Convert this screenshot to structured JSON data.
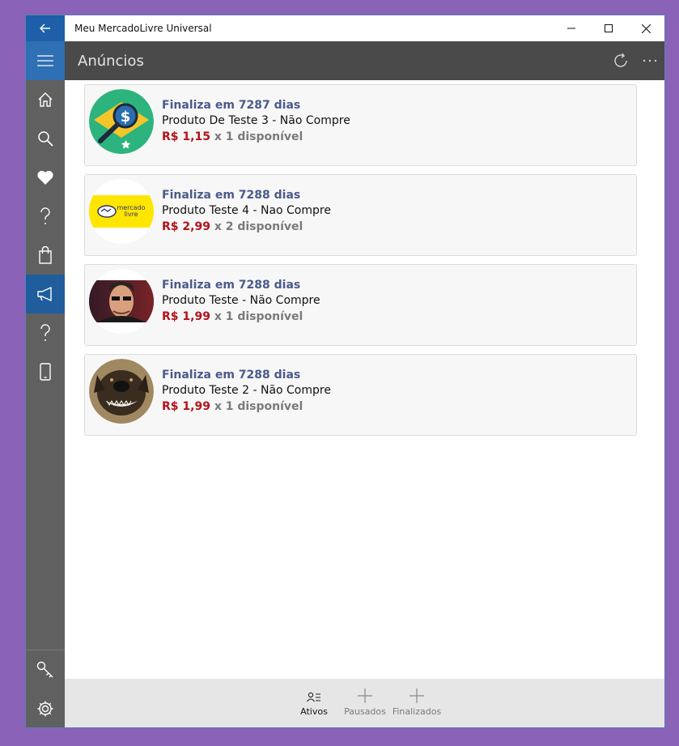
{
  "window": {
    "title": "Meu MercadoLivre Universal"
  },
  "header": {
    "title": "Anúncios"
  },
  "sidebar": {
    "items": [
      {
        "icon": "home-icon"
      },
      {
        "icon": "search-icon"
      },
      {
        "icon": "heart-icon"
      },
      {
        "icon": "help-icon"
      },
      {
        "icon": "shopping-bag-icon"
      },
      {
        "icon": "megaphone-icon",
        "active": true
      },
      {
        "icon": "help-icon"
      },
      {
        "icon": "phone-icon"
      }
    ],
    "bottom": [
      {
        "icon": "keys-icon"
      },
      {
        "icon": "gear-icon"
      }
    ]
  },
  "listings": [
    {
      "ends_label": "Finaliza em  7287 dias",
      "name": "Produto De Teste 3 - Não Compre",
      "price": "R$ 1,15",
      "qty": "x 1 disponível",
      "image": "dollar-magnifier"
    },
    {
      "ends_label": "Finaliza em  7288 dias",
      "name": "Produto Teste 4 - Nao Compre",
      "price": "R$ 2,99",
      "qty": "x 2 disponível",
      "image": "mercadolivre-logo",
      "logo_text": "mercado livre"
    },
    {
      "ends_label": "Finaliza em  7288 dias",
      "name": "Produto Teste - Não Compre",
      "price": "R$ 1,99",
      "qty": "x 1 disponível",
      "image": "man-portrait"
    },
    {
      "ends_label": "Finaliza em  7288 dias",
      "name": "Produto Teste 2 - Não Compre",
      "price": "R$ 1,99",
      "qty": "x 1 disponível",
      "image": "dog-photo"
    }
  ],
  "cmdbar": {
    "ativos": "Ativos",
    "pausados": "Pausados",
    "finalizados": "Finalizados"
  },
  "colors": {
    "accent": "#1f5d9d",
    "price": "#b4121b",
    "ends": "#4a5a8a",
    "header": "#4a4a4a",
    "sidebar": "#606060"
  }
}
